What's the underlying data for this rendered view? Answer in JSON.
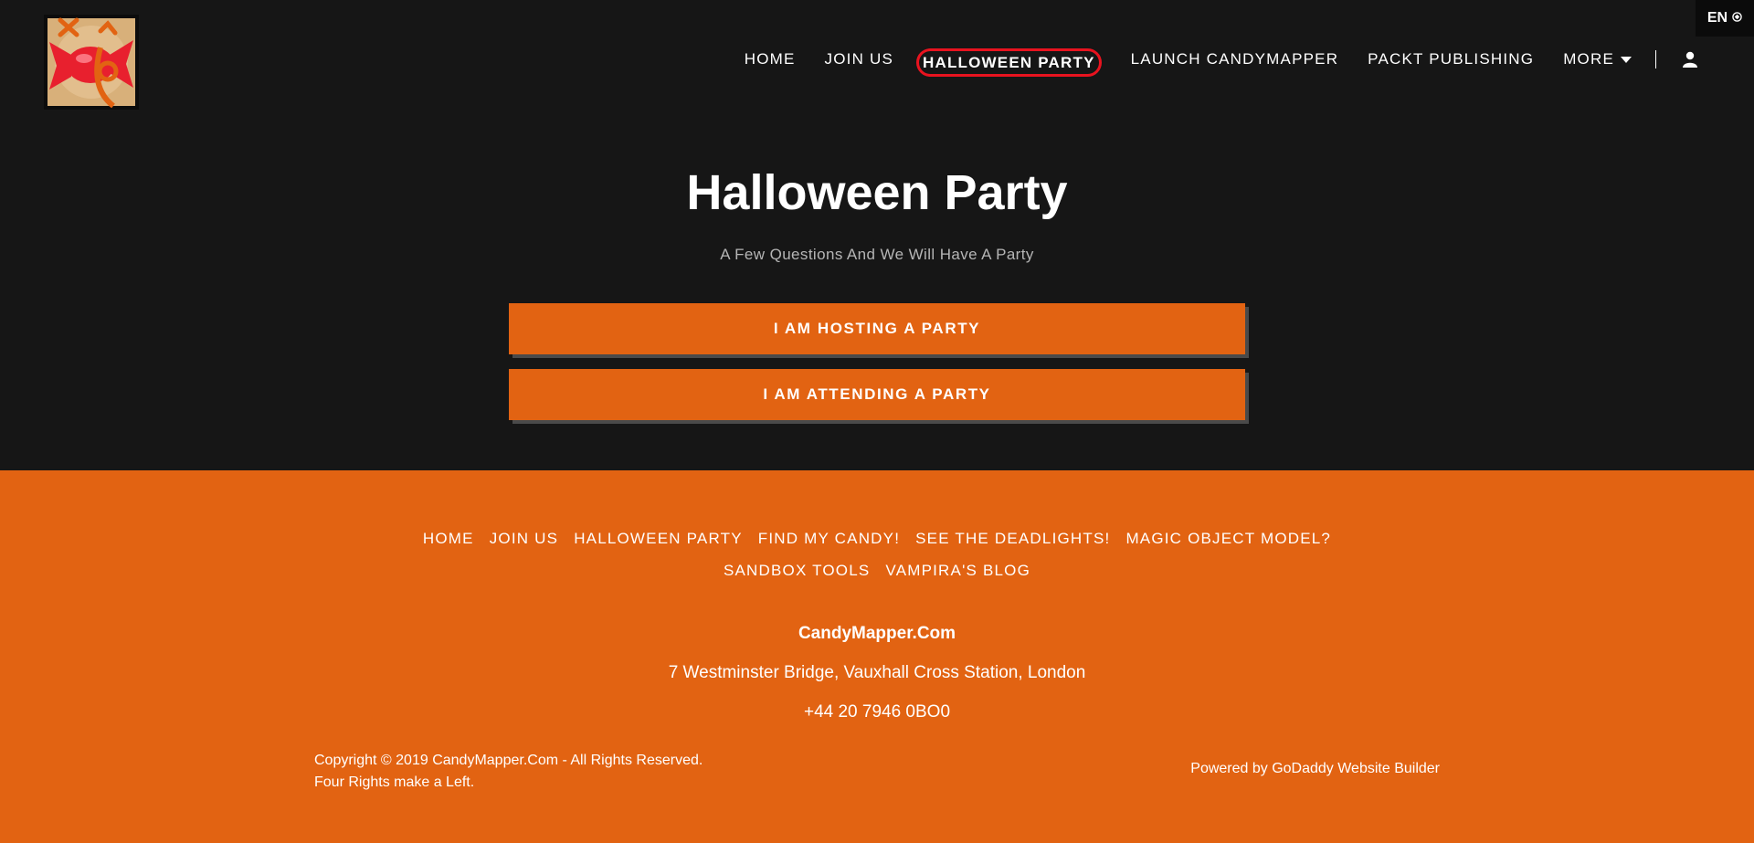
{
  "header": {
    "lang_label": "EN",
    "nav": [
      {
        "label": "HOME"
      },
      {
        "label": "JOIN US"
      },
      {
        "label": "HALLOWEEN PARTY",
        "active": true
      },
      {
        "label": "LAUNCH CANDYMAPPER"
      },
      {
        "label": "PACKT PUBLISHING"
      },
      {
        "label": "MORE"
      }
    ],
    "icons": [
      "candy-logo",
      "globe-icon",
      "chevron-down-icon",
      "user-icon"
    ]
  },
  "hero": {
    "title": "Halloween Party",
    "subtitle": "A Few Questions And We Will Have A Party",
    "buttons": [
      "I AM HOSTING A PARTY",
      "I AM ATTENDING A PARTY"
    ]
  },
  "footer": {
    "nav_row1": [
      "HOME",
      "JOIN US",
      "HALLOWEEN PARTY",
      "FIND MY CANDY!",
      "SEE THE DEADLIGHTS!",
      "MAGIC OBJECT MODEL?"
    ],
    "nav_row2": [
      "SANDBOX TOOLS",
      "VAMPIRA'S BLOG"
    ],
    "company": "CandyMapper.Com",
    "address": "7 Westminster Bridge, Vauxhall Cross Station, London",
    "phone": "+44 20 7946 0BO0",
    "copyright_line1": "Copyright © 2019 CandyMapper.Com - All Rights Reserved.",
    "copyright_line2": "Four Rights make a Left.",
    "powered_by": "Powered by GoDaddy Website Builder"
  },
  "colors": {
    "background": "#161616",
    "accent_orange": "#e26312",
    "active_outline": "#e8131f"
  }
}
